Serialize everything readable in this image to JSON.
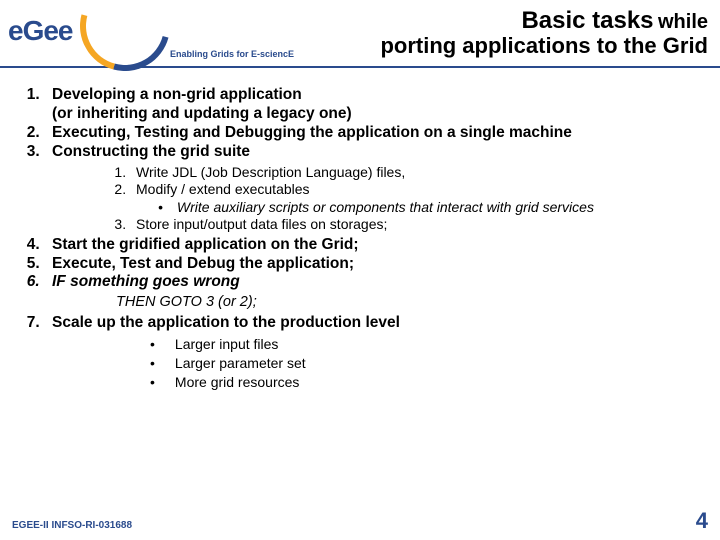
{
  "header": {
    "logo_text": "eGee",
    "tagline": "Enabling Grids for E-sciencE",
    "title_main": "Basic tasks",
    "title_while": "while",
    "title_sub": "porting applications to the Grid"
  },
  "items": {
    "i1": "Developing a non-grid application",
    "i1b": "(or inheriting and updating a legacy one)",
    "i2": "Executing, Testing and Debugging the application on a single machine",
    "i3": "Constructing the grid suite",
    "i3_1": "Write JDL (Job Description Language) files,",
    "i3_2": "Modify / extend executables",
    "i3_2a": "Write auxiliary scripts or components that interact with grid services",
    "i3_3": "Store input/output data files on storages;",
    "i4": "Start the gridified application on the Grid;",
    "i5": "Execute, Test and Debug the application;",
    "i6": "IF something goes wrong",
    "i6_then": "THEN GOTO 3 (or 2);",
    "i7": "Scale up the application to the production level",
    "i7_a": "Larger input files",
    "i7_b": "Larger parameter set",
    "i7_c": "More grid resources"
  },
  "footer": {
    "left": "EGEE-II INFSO-RI-031688",
    "page": "4"
  }
}
